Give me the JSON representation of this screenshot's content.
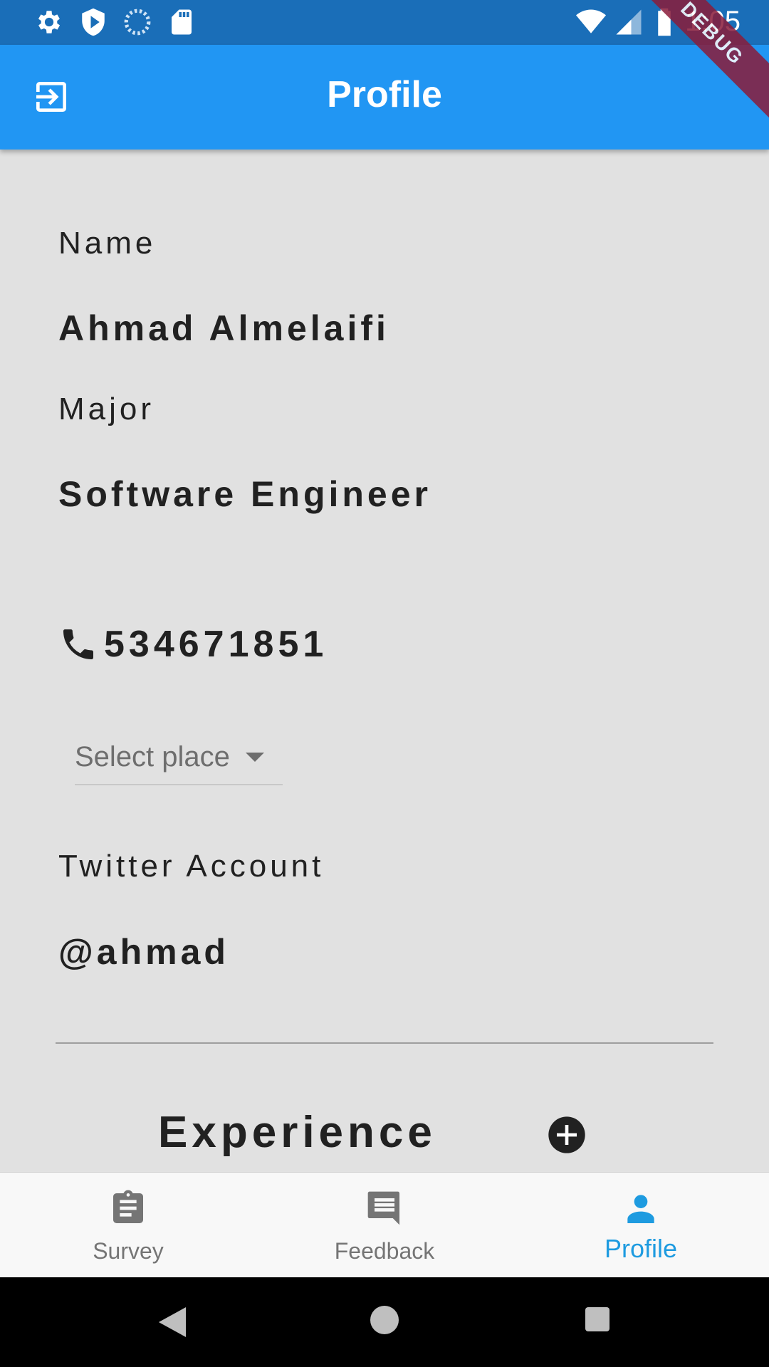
{
  "status_bar": {
    "time": "1:05",
    "left_icons": [
      "settings-icon",
      "shield-icon",
      "sync-icon",
      "sd-card-icon"
    ],
    "right_icons": [
      "wifi-icon",
      "signal-icon",
      "battery-icon"
    ]
  },
  "debug_banner": "DEBUG",
  "app_bar": {
    "title": "Profile",
    "leading_icon": "logout-icon",
    "color": "#2196f3"
  },
  "profile": {
    "name_label": "Name",
    "name_value": "Ahmad Almelaifi",
    "major_label": "Major",
    "major_value": "Software Engineer",
    "phone": "534671851",
    "place_dropdown": {
      "placeholder": "Select place"
    },
    "twitter_label": "Twitter Account",
    "twitter_value": "@ahmad",
    "experience_title": "Experience"
  },
  "bottom_nav": {
    "items": [
      {
        "label": "Survey",
        "icon": "clipboard-icon",
        "active": false
      },
      {
        "label": "Feedback",
        "icon": "chat-icon",
        "active": false
      },
      {
        "label": "Profile",
        "icon": "person-icon",
        "active": true
      }
    ],
    "active_color": "#1e9be0",
    "inactive_color": "#757575"
  },
  "system_nav": [
    "back-icon",
    "home-icon",
    "recents-icon"
  ]
}
